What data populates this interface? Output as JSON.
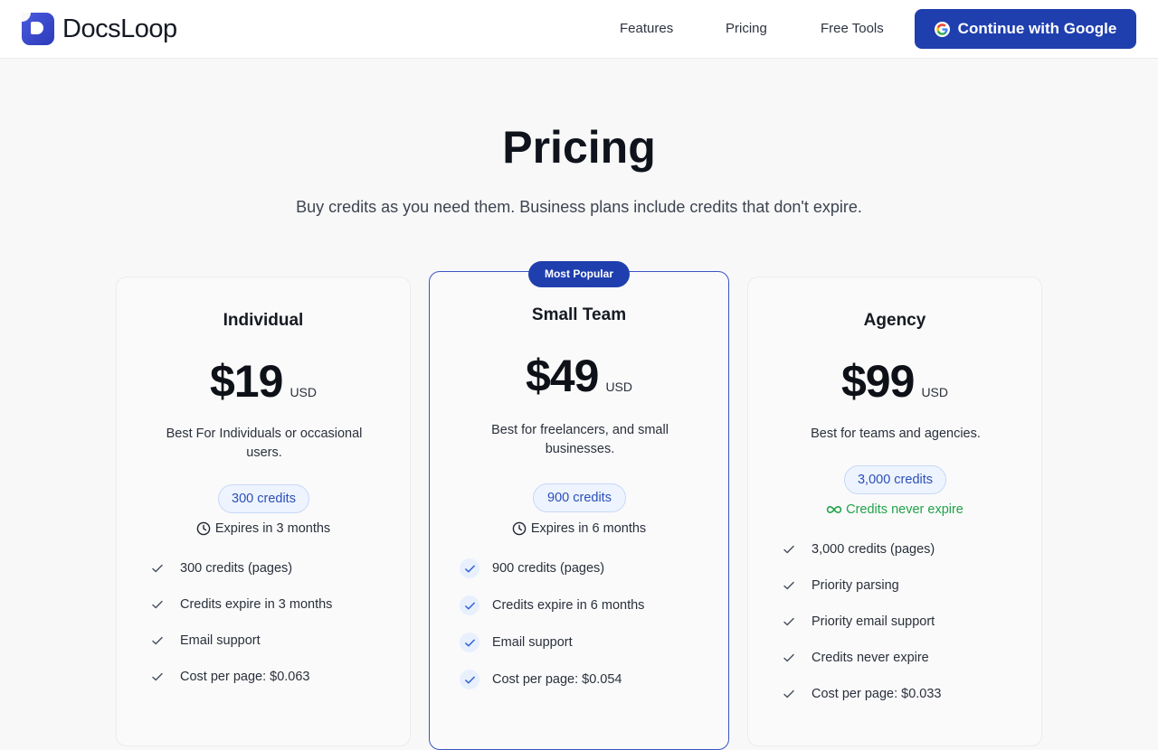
{
  "header": {
    "brand": "DocsLoop",
    "nav": [
      "Features",
      "Pricing",
      "Free Tools"
    ],
    "google_button": "Continue with Google"
  },
  "hero": {
    "title": "Pricing",
    "subtitle": "Buy credits as you need them. Business plans include credits that don't expire."
  },
  "plans": [
    {
      "name": "Individual",
      "price": "$19",
      "currency": "USD",
      "description": "Best For Individuals or occasional users.",
      "credits": "300 credits",
      "expiry": "Expires in 3 months",
      "features": [
        "300 credits (pages)",
        "Credits expire in 3 months",
        "Email support",
        "Cost per page: $0.063"
      ]
    },
    {
      "name": "Small Team",
      "badge": "Most Popular",
      "price": "$49",
      "currency": "USD",
      "description": "Best for freelancers, and small businesses.",
      "credits": "900 credits",
      "expiry": "Expires in 6 months",
      "features": [
        "900 credits (pages)",
        "Credits expire in 6 months",
        "Email support",
        "Cost per page: $0.054"
      ]
    },
    {
      "name": "Agency",
      "price": "$99",
      "currency": "USD",
      "description": "Best for teams and agencies.",
      "credits": "3,000 credits",
      "expiry": "Credits never expire",
      "features": [
        "3,000 credits (pages)",
        "Priority parsing",
        "Priority email support",
        "Credits never expire",
        "Cost per page: $0.033"
      ]
    }
  ],
  "colors": {
    "accent": "#1f3fae",
    "pill_text": "#2a4fb8",
    "never_expire": "#22a24a"
  }
}
